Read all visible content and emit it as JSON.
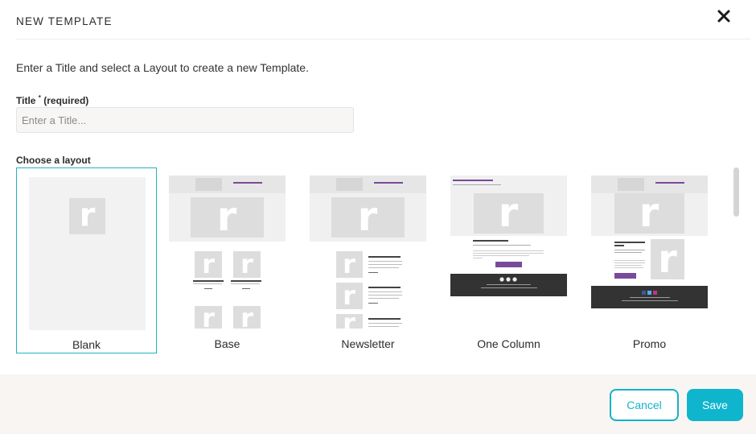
{
  "dialog": {
    "title": "NEW TEMPLATE",
    "intro": "Enter a Title and select a Layout to create a new Template."
  },
  "title_field": {
    "label": "Title",
    "required_mark": "*",
    "required_text": "(required)",
    "placeholder": "Enter a Title...",
    "value": ""
  },
  "layouts": {
    "label": "Choose a layout",
    "selected": "Blank",
    "items": [
      {
        "name": "Blank"
      },
      {
        "name": "Base"
      },
      {
        "name": "Newsletter"
      },
      {
        "name": "One Column"
      },
      {
        "name": "Promo"
      }
    ]
  },
  "footer": {
    "cancel_label": "Cancel",
    "save_label": "Save"
  },
  "colors": {
    "accent": "#14b3c7",
    "save_bg": "#0fb5cd",
    "footer_bg": "#f8f5f3",
    "template_purple": "#7a4a9a",
    "template_dark": "#333333"
  },
  "icons": [
    "close-icon",
    "placeholder-image-icon"
  ]
}
